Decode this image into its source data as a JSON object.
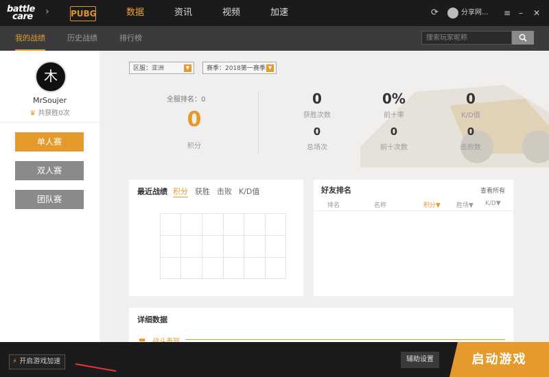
{
  "header": {
    "logo_line1": "battle",
    "logo_line2": "care",
    "game_logo": "PUBG",
    "nav": [
      "数据",
      "资讯",
      "视频",
      "加速"
    ],
    "active_nav": "数据",
    "user_name": "分享网..."
  },
  "subnav": {
    "items": [
      "我的战绩",
      "历史战绩",
      "排行榜"
    ],
    "active": "我的战绩",
    "search_placeholder": "搜索玩家昵称"
  },
  "sidebar": {
    "avatar_char": "木",
    "username": "MrSoujer",
    "wins_text": "共获胜0次",
    "modes": [
      {
        "label": "单人赛",
        "active": true
      },
      {
        "label": "双人赛",
        "active": false
      },
      {
        "label": "团队赛",
        "active": false
      }
    ]
  },
  "filters": {
    "region": "区服：亚洲",
    "season": "赛季：2018第一赛季"
  },
  "stats": {
    "rank_label": "全服排名：0",
    "score_value": "0",
    "score_label": "积分",
    "items": [
      {
        "value": "0",
        "label": "获胜次数"
      },
      {
        "value": "0%",
        "label": "前十率"
      },
      {
        "value": "0",
        "label": "K/D值"
      },
      {
        "value": "0",
        "label": "总场次"
      },
      {
        "value": "0",
        "label": "前十次数"
      },
      {
        "value": "0",
        "label": "击败数"
      }
    ]
  },
  "recent": {
    "title": "最近战绩",
    "tabs": [
      "积分",
      "获胜",
      "击败",
      "K/D值"
    ],
    "active_tab": "积分"
  },
  "friends": {
    "title": "好友排名",
    "view_all": "查看所有",
    "columns": [
      "排名",
      "名称",
      "积分▼",
      "胜场▼",
      "K/D▼"
    ],
    "active_column": "积分▼"
  },
  "detail": {
    "title": "详细数据",
    "section": "战斗表现"
  },
  "footer": {
    "accel_label": "开启游戏加速",
    "assist_label": "辅助设置",
    "launch_label": "启动游戏"
  },
  "colors": {
    "accent": "#e49a2d",
    "topbar": "#1b1b1d",
    "mode_active": "#e49a2d",
    "mode_inactive": "#8a8a8a"
  }
}
